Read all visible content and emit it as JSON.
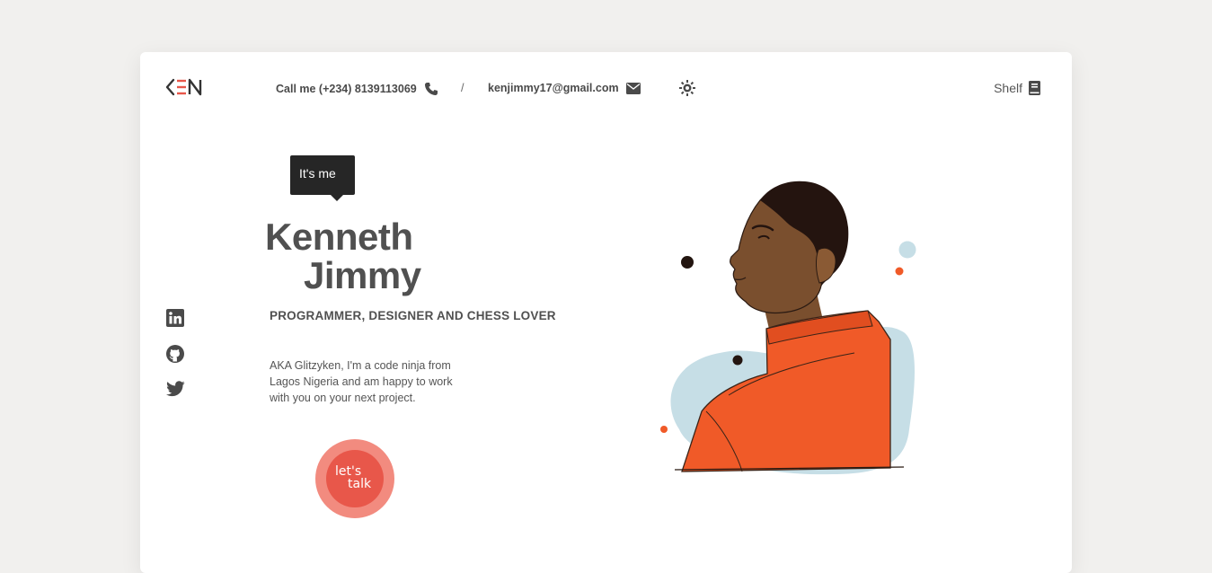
{
  "header": {
    "logo_text": "KEN",
    "phone_text": "Call me (+234) 8139113069",
    "separator": "/",
    "email_text": "kenjimmy17@gmail.com",
    "shelf_label": "Shelf",
    "icons": {
      "phone": "phone-icon",
      "email": "envelope-icon",
      "theme": "sun-icon",
      "shelf": "book-icon"
    }
  },
  "hero": {
    "tooltip": "It's me",
    "first_name": "Kenneth",
    "last_name": "Jimmy",
    "tagline": "PROGRAMMER, DESIGNER AND CHESS LOVER",
    "bio_lines": [
      "AKA Glitzyken, I'm a code ninja from",
      "Lagos Nigeria and am happy to work",
      "with you on your next project."
    ],
    "cta_line1": "let's",
    "cta_line2": "talk"
  },
  "socials": [
    "linkedin-icon",
    "github-icon",
    "twitter-icon"
  ],
  "colors": {
    "accent": "#e8574a",
    "accent_light": "#f28b7f",
    "shirt": "#f05a28",
    "text": "#505050",
    "background": "#f1f0ee"
  }
}
